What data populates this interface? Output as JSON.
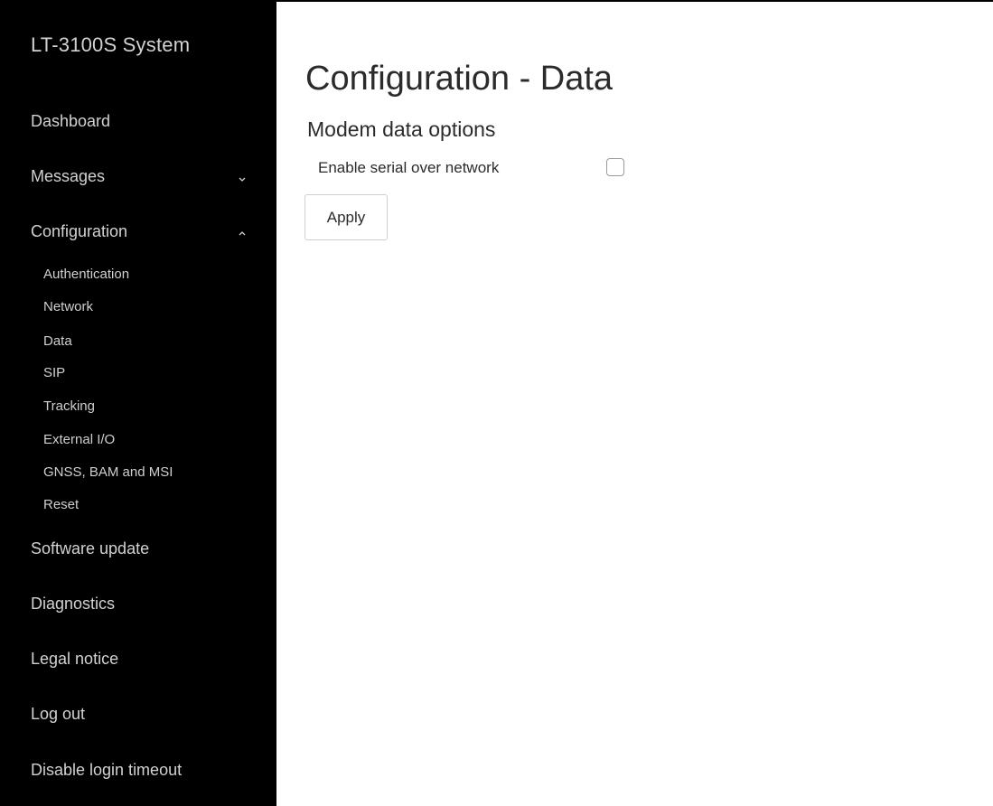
{
  "sidebar": {
    "brand": "LT-3100S System",
    "items": [
      {
        "label": "Dashboard"
      },
      {
        "label": "Messages",
        "chevron": "chevron-down-icon"
      },
      {
        "label": "Configuration",
        "chevron": "chevron-up-icon"
      },
      {
        "label": "Software update"
      },
      {
        "label": "Diagnostics"
      },
      {
        "label": "Legal notice"
      },
      {
        "label": "Log out"
      },
      {
        "label": "Disable login timeout"
      }
    ],
    "config_subitems": [
      {
        "label": "Authentication"
      },
      {
        "label": "Network"
      },
      {
        "label": "Data"
      },
      {
        "label": "SIP"
      },
      {
        "label": "Tracking"
      },
      {
        "label": "External I/O"
      },
      {
        "label": "GNSS, BAM and MSI"
      },
      {
        "label": "Reset"
      }
    ]
  },
  "main": {
    "title": "Configuration - Data",
    "section_title": "Modem data options",
    "fields": [
      {
        "label": "Enable serial over network",
        "checked": false
      }
    ],
    "apply_label": "Apply"
  }
}
